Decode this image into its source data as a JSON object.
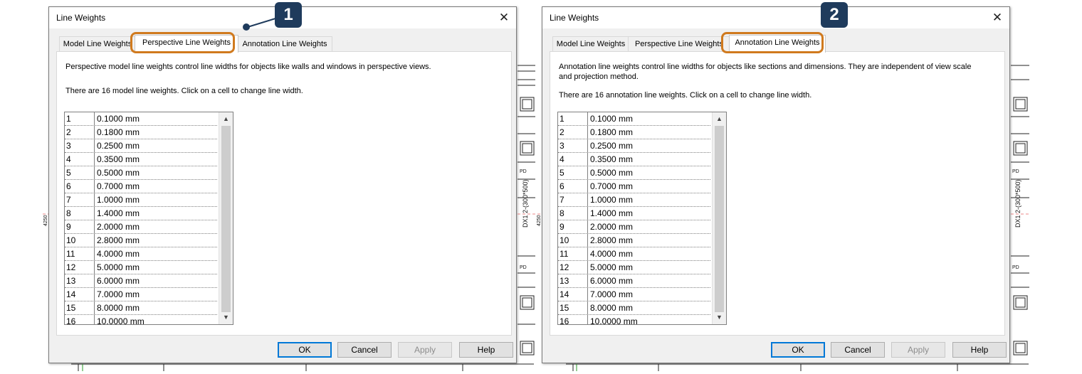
{
  "dialogs": [
    {
      "title": "Line Weights",
      "tabs": [
        "Model Line Weights",
        "Perspective Line Weights",
        "Annotation Line Weights"
      ],
      "active_tab": "Perspective Line Weights",
      "description": "Perspective model line weights control line widths for objects like walls and windows in perspective views.",
      "count_text": "There are 16 model line weights. Click on a cell to change line width.",
      "rows": [
        {
          "num": "1",
          "value": "0.1000 mm"
        },
        {
          "num": "2",
          "value": "0.1800 mm"
        },
        {
          "num": "3",
          "value": "0.2500 mm"
        },
        {
          "num": "4",
          "value": "0.3500 mm"
        },
        {
          "num": "5",
          "value": "0.5000 mm"
        },
        {
          "num": "6",
          "value": "0.7000 mm"
        },
        {
          "num": "7",
          "value": "1.0000 mm"
        },
        {
          "num": "8",
          "value": "1.4000 mm"
        },
        {
          "num": "9",
          "value": "2.0000 mm"
        },
        {
          "num": "10",
          "value": "2.8000 mm"
        },
        {
          "num": "11",
          "value": "4.0000 mm"
        },
        {
          "num": "12",
          "value": "5.0000 mm"
        },
        {
          "num": "13",
          "value": "6.0000 mm"
        },
        {
          "num": "14",
          "value": "7.0000 mm"
        },
        {
          "num": "15",
          "value": "8.0000 mm"
        },
        {
          "num": "16",
          "value": "10.0000 mm"
        }
      ],
      "buttons": {
        "ok": "OK",
        "cancel": "Cancel",
        "apply": "Apply",
        "help": "Help"
      },
      "callout": "1",
      "close_icon": "close-icon"
    },
    {
      "title": "Line Weights",
      "tabs": [
        "Model Line Weights",
        "Perspective Line Weights",
        "Annotation Line Weights"
      ],
      "active_tab": "Annotation Line Weights",
      "description": "Annotation line weights control line widths for objects like sections and dimensions. They are independent of view scale and projection method.",
      "count_text": "There are 16 annotation line weights. Click on a cell to change line width.",
      "rows": [
        {
          "num": "1",
          "value": "0.1000 mm"
        },
        {
          "num": "2",
          "value": "0.1800 mm"
        },
        {
          "num": "3",
          "value": "0.2500 mm"
        },
        {
          "num": "4",
          "value": "0.3500 mm"
        },
        {
          "num": "5",
          "value": "0.5000 mm"
        },
        {
          "num": "6",
          "value": "0.7000 mm"
        },
        {
          "num": "7",
          "value": "1.0000 mm"
        },
        {
          "num": "8",
          "value": "1.4000 mm"
        },
        {
          "num": "9",
          "value": "2.0000 mm"
        },
        {
          "num": "10",
          "value": "2.8000 mm"
        },
        {
          "num": "11",
          "value": "4.0000 mm"
        },
        {
          "num": "12",
          "value": "5.0000 mm"
        },
        {
          "num": "13",
          "value": "6.0000 mm"
        },
        {
          "num": "14",
          "value": "7.0000 mm"
        },
        {
          "num": "15",
          "value": "8.0000 mm"
        },
        {
          "num": "16",
          "value": "10.0000 mm"
        }
      ],
      "buttons": {
        "ok": "OK",
        "cancel": "Cancel",
        "apply": "Apply",
        "help": "Help"
      },
      "callout": "2",
      "close_icon": "close-icon"
    }
  ],
  "background": {
    "labels": {
      "grid_tag": "DX1 2-(300*500)",
      "small_mark": "PD",
      "dim_left": "4250"
    }
  },
  "colors": {
    "highlight": "#d07a1e",
    "callout": "#1f3b5c",
    "default_button_border": "#0078d7"
  }
}
